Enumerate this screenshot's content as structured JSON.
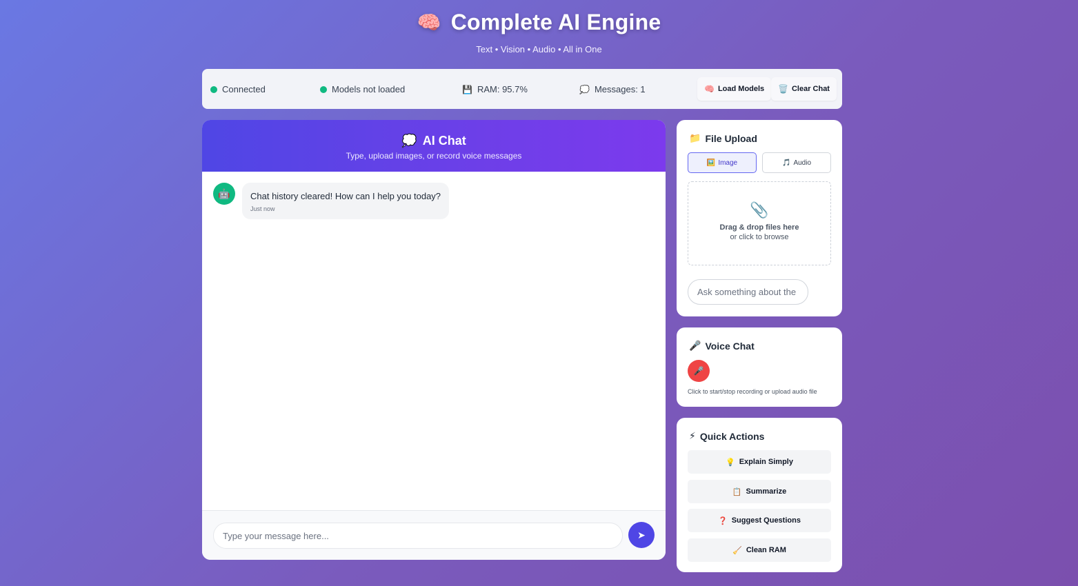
{
  "header": {
    "icon": "brain-icon",
    "icon_glyph": "🧠",
    "title": "Complete AI Engine",
    "subtitle": "Text • Vision • Audio • All in One"
  },
  "status": {
    "connection": "Connected",
    "models": "Models not loaded",
    "ram_glyph": "💾",
    "ram": "RAM: 95.7%",
    "messages_glyph": "💭",
    "messages": "Messages: 1",
    "status_color": "#10b981",
    "load_models_glyph": "🧠",
    "load_models": "Load Models",
    "clear_chat_glyph": "🗑️",
    "clear_chat": "Clear Chat"
  },
  "chat": {
    "title_glyph": "💭",
    "title": "AI Chat",
    "subtitle": "Type, upload images, or record voice messages",
    "messages": [
      {
        "avatar_glyph": "🤖",
        "text": "Chat history cleared! How can I help you today?",
        "time": "Just now"
      }
    ],
    "input_placeholder": "Type your message here...",
    "send_glyph": "➤",
    "accent": "#4f46e5"
  },
  "file_upload": {
    "title_glyph": "📁",
    "title": "File Upload",
    "tabs": [
      {
        "glyph": "🖼️",
        "label": "Image",
        "active": true
      },
      {
        "glyph": "🎵",
        "label": "Audio",
        "active": false
      }
    ],
    "drop_glyph": "📎",
    "drop_title": "Drag & drop files here",
    "drop_sub": "or click to browse",
    "ask_placeholder": "Ask something about the file..."
  },
  "voice_chat": {
    "title_glyph": "🎤",
    "title": "Voice Chat",
    "mic_glyph": "🎤",
    "hint": "Click to start/stop recording or upload audio file",
    "mic_color": "#ef4444"
  },
  "quick_actions": {
    "title_glyph": "⚡",
    "title": "Quick Actions",
    "items": [
      {
        "glyph": "💡",
        "label": "Explain Simply"
      },
      {
        "glyph": "📋",
        "label": "Summarize"
      },
      {
        "glyph": "❓",
        "label": "Suggest Questions"
      },
      {
        "glyph": "🧹",
        "label": "Clean RAM"
      }
    ]
  }
}
